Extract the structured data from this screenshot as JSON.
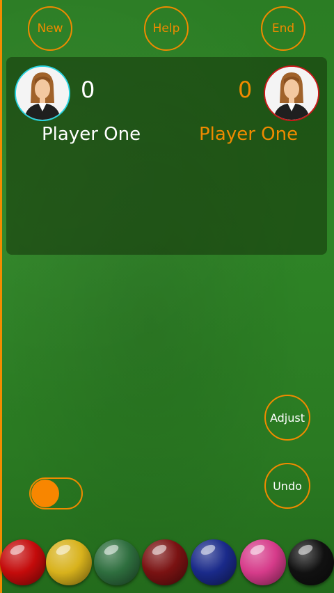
{
  "top_bar": {
    "new_label": "New",
    "help_label": "Help",
    "end_label": "End"
  },
  "players": [
    {
      "name": "Player One",
      "score": "0",
      "ring_color": "#29d3e0"
    },
    {
      "name": "Player One",
      "score": "0",
      "ring_color": "#c81818"
    }
  ],
  "controls": {
    "adjust_label": "Adjust",
    "undo_label": "Undo",
    "toggle_on": true
  },
  "balls": [
    {
      "name": "red",
      "color": "#c40b0b"
    },
    {
      "name": "yellow",
      "color": "#d8b21c"
    },
    {
      "name": "green",
      "color": "#2e6e3e"
    },
    {
      "name": "brown",
      "color": "#7a1212"
    },
    {
      "name": "blue",
      "color": "#1a2a8a"
    },
    {
      "name": "pink",
      "color": "#d63b8a"
    },
    {
      "name": "black",
      "color": "#111111"
    }
  ],
  "colors": {
    "accent": "#f08a00",
    "felt": "#2b7d24"
  }
}
